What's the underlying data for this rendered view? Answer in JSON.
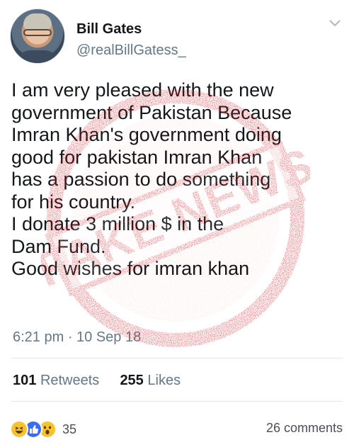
{
  "author": {
    "name": "Bill Gates",
    "handle": "@realBillGatess_"
  },
  "tweet": {
    "text": "I am very pleased with the new\ngovernment of Pakistan Because\nImran Khan's government doing\ngood for pakistan Imran Khan\nhas a passion to do something\nfor his country.\nI donate 3 million $ in the\nDam Fund.\nGood wishes for imran khan",
    "timestamp": "6:21 pm · 10 Sep 18"
  },
  "stamp": {
    "text": "FAKE NEWS",
    "color": "#e0202a"
  },
  "stats": {
    "retweets_count": "101",
    "retweets_label": "Retweets",
    "likes_count": "255",
    "likes_label": "Likes"
  },
  "reactions": {
    "icons": [
      "haha-icon",
      "like-icon",
      "wow-icon"
    ],
    "count": "35"
  },
  "comments": {
    "label": "26 comments"
  }
}
